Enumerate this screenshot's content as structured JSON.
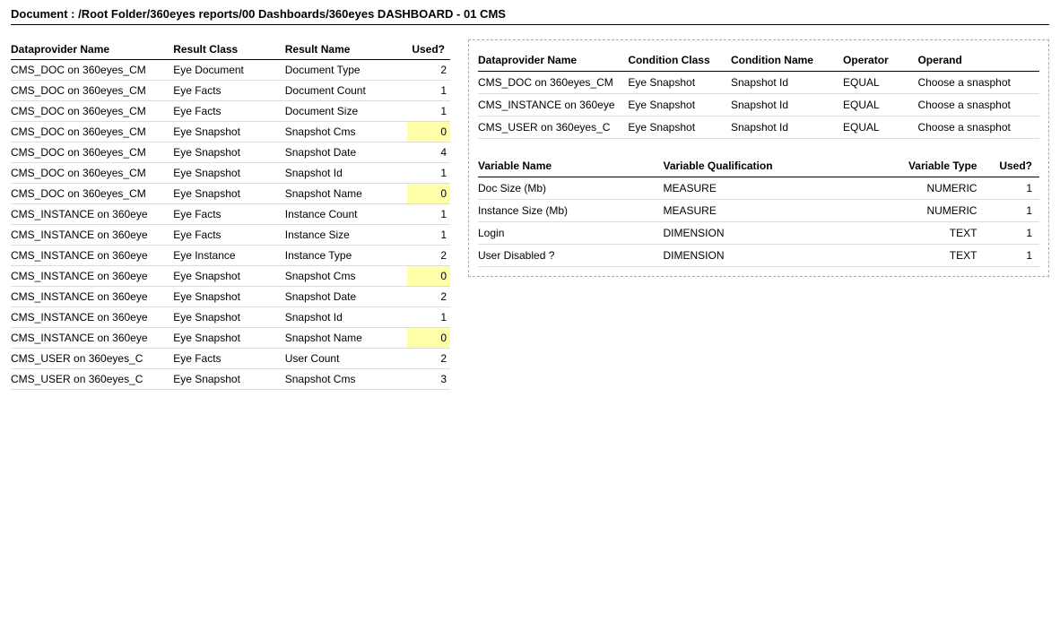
{
  "document": {
    "title": "Document : /Root Folder/360eyes reports/00 Dashboards/360eyes DASHBOARD - 01 CMS"
  },
  "leftTable": {
    "headers": [
      "Dataprovider Name",
      "Result Class",
      "Result Name",
      "Used?"
    ],
    "rows": [
      {
        "dataprovider": "CMS_DOC on 360eyes_CM",
        "resultClass": "Eye Document",
        "resultName": "Document Type",
        "used": "2",
        "highlight": false
      },
      {
        "dataprovider": "CMS_DOC on 360eyes_CM",
        "resultClass": "Eye Facts",
        "resultName": "Document Count",
        "used": "1",
        "highlight": false
      },
      {
        "dataprovider": "CMS_DOC on 360eyes_CM",
        "resultClass": "Eye Facts",
        "resultName": "Document Size",
        "used": "1",
        "highlight": false
      },
      {
        "dataprovider": "CMS_DOC on 360eyes_CM",
        "resultClass": "Eye Snapshot",
        "resultName": "Snapshot Cms",
        "used": "0",
        "highlight": true
      },
      {
        "dataprovider": "CMS_DOC on 360eyes_CM",
        "resultClass": "Eye Snapshot",
        "resultName": "Snapshot Date",
        "used": "4",
        "highlight": false
      },
      {
        "dataprovider": "CMS_DOC on 360eyes_CM",
        "resultClass": "Eye Snapshot",
        "resultName": "Snapshot Id",
        "used": "1",
        "highlight": false
      },
      {
        "dataprovider": "CMS_DOC on 360eyes_CM",
        "resultClass": "Eye Snapshot",
        "resultName": "Snapshot Name",
        "used": "0",
        "highlight": true
      },
      {
        "dataprovider": "CMS_INSTANCE on 360eye",
        "resultClass": "Eye Facts",
        "resultName": "Instance Count",
        "used": "1",
        "highlight": false
      },
      {
        "dataprovider": "CMS_INSTANCE on 360eye",
        "resultClass": "Eye Facts",
        "resultName": "Instance Size",
        "used": "1",
        "highlight": false
      },
      {
        "dataprovider": "CMS_INSTANCE on 360eye",
        "resultClass": "Eye Instance",
        "resultName": "Instance Type",
        "used": "2",
        "highlight": false
      },
      {
        "dataprovider": "CMS_INSTANCE on 360eye",
        "resultClass": "Eye Snapshot",
        "resultName": "Snapshot Cms",
        "used": "0",
        "highlight": true
      },
      {
        "dataprovider": "CMS_INSTANCE on 360eye",
        "resultClass": "Eye Snapshot",
        "resultName": "Snapshot Date",
        "used": "2",
        "highlight": false
      },
      {
        "dataprovider": "CMS_INSTANCE on 360eye",
        "resultClass": "Eye Snapshot",
        "resultName": "Snapshot Id",
        "used": "1",
        "highlight": false
      },
      {
        "dataprovider": "CMS_INSTANCE on 360eye",
        "resultClass": "Eye Snapshot",
        "resultName": "Snapshot Name",
        "used": "0",
        "highlight": true
      },
      {
        "dataprovider": "CMS_USER on 360eyes_C",
        "resultClass": "Eye Facts",
        "resultName": "User Count",
        "used": "2",
        "highlight": false
      },
      {
        "dataprovider": "CMS_USER on 360eyes_C",
        "resultClass": "Eye Snapshot",
        "resultName": "Snapshot Cms",
        "used": "3",
        "highlight": false
      }
    ]
  },
  "rightTopTable": {
    "headers": [
      "Dataprovider Name",
      "Condition Class",
      "Condition Name",
      "Operator",
      "Operand"
    ],
    "rows": [
      {
        "dataprovider": "CMS_DOC on 360eyes_CM",
        "conditionClass": "Eye Snapshot",
        "conditionName": "Snapshot Id",
        "operator": "EQUAL",
        "operand": "Choose a snasphot"
      },
      {
        "dataprovider": "CMS_INSTANCE on 360eye",
        "conditionClass": "Eye Snapshot",
        "conditionName": "Snapshot Id",
        "operator": "EQUAL",
        "operand": "Choose a snasphot"
      },
      {
        "dataprovider": "CMS_USER on 360eyes_C",
        "conditionClass": "Eye Snapshot",
        "conditionName": "Snapshot Id",
        "operator": "EQUAL",
        "operand": "Choose a snasphot"
      }
    ]
  },
  "rightBottomTable": {
    "headers": [
      "Variable Name",
      "Variable Qualification",
      "Variable Type",
      "Used?"
    ],
    "rows": [
      {
        "varName": "Doc Size (Mb)",
        "varQual": "MEASURE",
        "varType": "NUMERIC",
        "used": "1"
      },
      {
        "varName": "Instance Size (Mb)",
        "varQual": "MEASURE",
        "varType": "NUMERIC",
        "used": "1"
      },
      {
        "varName": "Login",
        "varQual": "DIMENSION",
        "varType": "TEXT",
        "used": "1"
      },
      {
        "varName": "User Disabled ?",
        "varQual": "DIMENSION",
        "varType": "TEXT",
        "used": "1"
      }
    ]
  }
}
